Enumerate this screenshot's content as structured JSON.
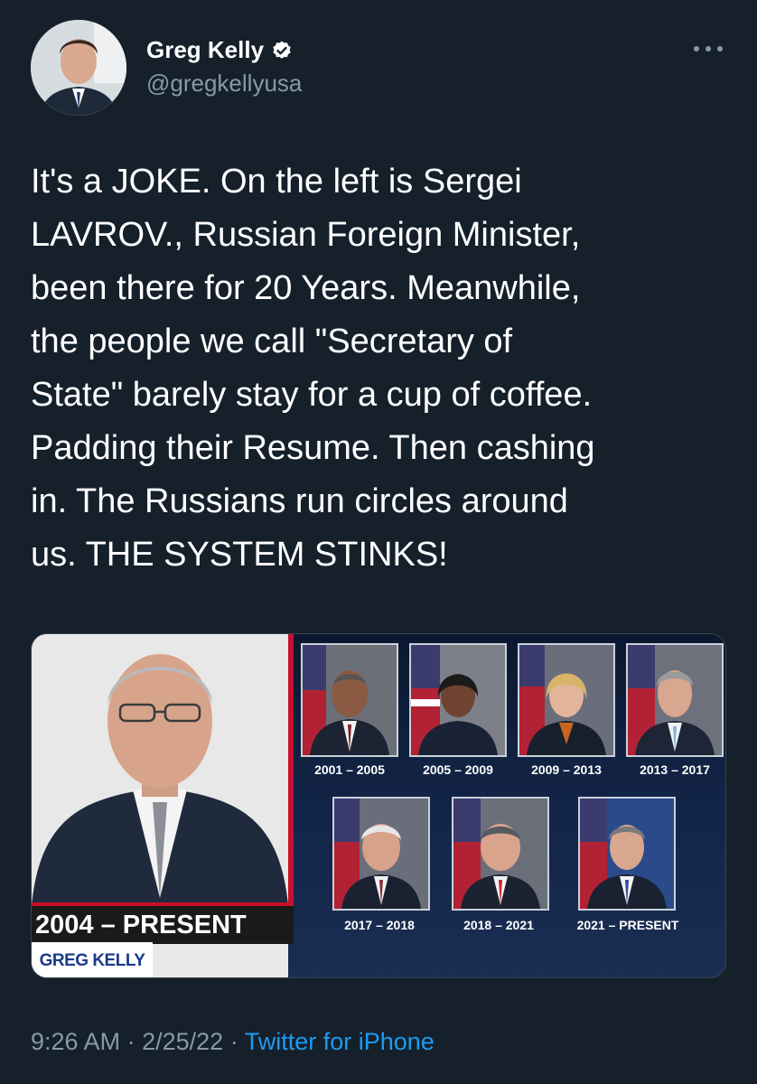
{
  "author": {
    "display_name": "Greg Kelly",
    "handle": "@gregkellyusa",
    "verified": true,
    "avatar_icon": "profile-photo"
  },
  "tweet": {
    "text": "It's a JOKE.  On the left is Sergei\nLAVROV., Russian Foreign Minister,\nbeen there for 20 Years. Meanwhile,\nthe people we call \"Secretary of\nState\" barely stay for a cup of coffee.\nPadding their Resume.  Then cashing\nin.  The Russians run circles around\nus. THE SYSTEM STINKS!"
  },
  "media": {
    "lavrov_term": "2004 – PRESENT",
    "logo_text": "GREG KELLY",
    "secretaries": [
      {
        "term": "2001 – 2005"
      },
      {
        "term": "2005 – 2009"
      },
      {
        "term": "2009 – 2013"
      },
      {
        "term": "2013 – 2017"
      },
      {
        "term": "2017 – 2018"
      },
      {
        "term": "2018 – 2021"
      },
      {
        "term": "2021 – PRESENT"
      }
    ]
  },
  "meta": {
    "time": "9:26 AM",
    "date": "2/25/22",
    "separator": "·",
    "source": "Twitter for iPhone"
  },
  "colors": {
    "background": "#15202b",
    "secondary_text": "#8899a6",
    "link": "#1d9bf0",
    "accent_red": "#c8102e"
  }
}
